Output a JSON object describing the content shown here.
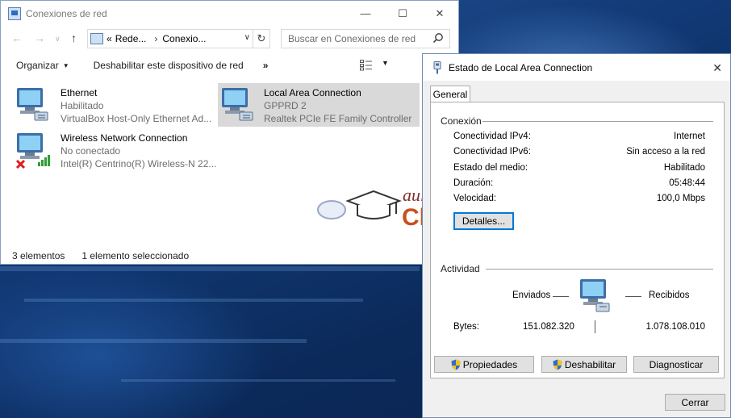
{
  "explorer": {
    "title": "Conexiones de red",
    "breadcrumb": {
      "prefix": "«",
      "items": [
        "Rede...",
        "Conexio..."
      ]
    },
    "search_placeholder": "Buscar en Conexiones de red",
    "commands": {
      "organize": "Organizar",
      "disable": "Deshabilitar este dispositivo de red",
      "more": "»"
    },
    "items": [
      {
        "name": "Ethernet",
        "status": "Habilitado",
        "device": "VirtualBox Host-Only Ethernet Ad...",
        "selected": false,
        "disconnected": false,
        "wireless": false
      },
      {
        "name": "Local Area Connection",
        "status": "GPPRD  2",
        "device": "Realtek PCIe FE Family Controller",
        "selected": true,
        "disconnected": false,
        "wireless": false
      },
      {
        "name": "Wireless Network Connection",
        "status": "No conectado",
        "device": "Intel(R) Centrino(R) Wireless-N 22...",
        "selected": false,
        "disconnected": true,
        "wireless": true
      }
    ],
    "status": {
      "count": "3 elementos",
      "selection": "1 elemento seleccionado"
    }
  },
  "dialog": {
    "title": "Estado de Local Area Connection",
    "tab": "General",
    "connection": {
      "heading": "Conexión",
      "rows": [
        {
          "label": "Conectividad IPv4:",
          "value": "Internet"
        },
        {
          "label": "Conectividad IPv6:",
          "value": "Sin acceso a la red"
        },
        {
          "label": "Estado del medio:",
          "value": "Habilitado"
        },
        {
          "label": "Duración:",
          "value": "05:48:44"
        },
        {
          "label": "Velocidad:",
          "value": "100,0 Mbps"
        }
      ],
      "details_button": "Detalles..."
    },
    "activity": {
      "heading": "Actividad",
      "sent_label": "Enviados",
      "received_label": "Recibidos",
      "bytes_label": "Bytes:",
      "bytes_sent": "151.082.320",
      "bytes_received": "1.078.108.010"
    },
    "buttons": {
      "properties": "Propiedades",
      "disable": "Deshabilitar",
      "diagnose": "Diagnosticar",
      "close": "Cerrar"
    }
  },
  "watermark": {
    "line1": "aula",
    "line2": "Clic"
  },
  "colors": {
    "accent": "#0078d7",
    "watermark_red": "#c8501e",
    "selection": "#d9d9d9"
  }
}
